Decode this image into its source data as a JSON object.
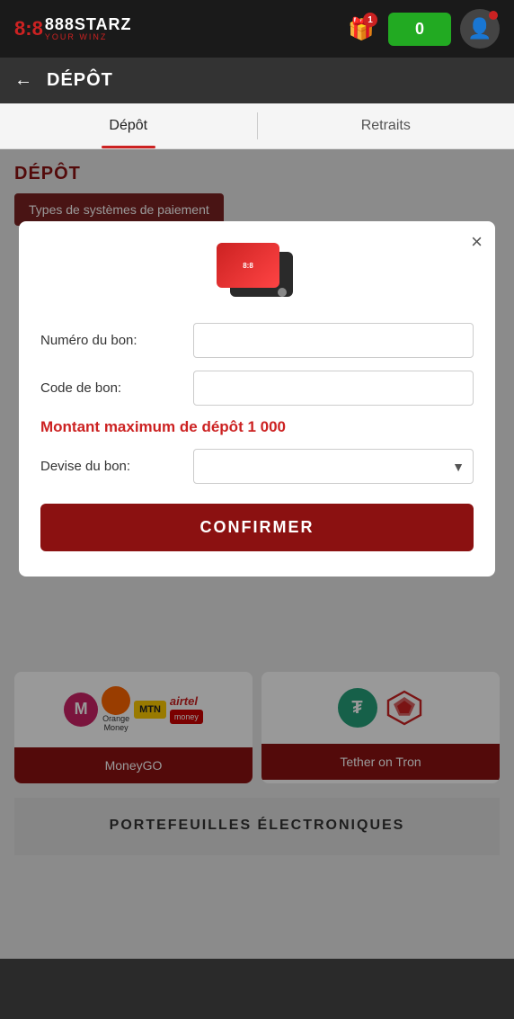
{
  "app": {
    "title": "888STARZ",
    "tagline": "YOUR WINZ"
  },
  "nav": {
    "gift_badge": "1",
    "balance": "0"
  },
  "page": {
    "back_label": "←",
    "title": "DÉPÔT"
  },
  "tabs": {
    "deposit_label": "Dépôt",
    "withdraw_label": "Retraits"
  },
  "section": {
    "title": "DÉPÔT",
    "payment_types_btn": "Types de systèmes de paiement"
  },
  "modal": {
    "close_label": "×",
    "field_numero_label": "Numéro du bon:",
    "field_code_label": "Code de bon:",
    "max_amount_text": "Montant maximum de dépôt 1 000",
    "field_devise_label": "Devise du bon:",
    "confirm_btn": "CONFIRMER"
  },
  "payment_cards": [
    {
      "id": "moneygo",
      "btn_label": "MoneyGO"
    },
    {
      "id": "tether",
      "btn_label": "Tether on Tron"
    }
  ],
  "portefeuilles": {
    "title": "PORTEFEUILLES ÉLECTRONIQUES"
  }
}
